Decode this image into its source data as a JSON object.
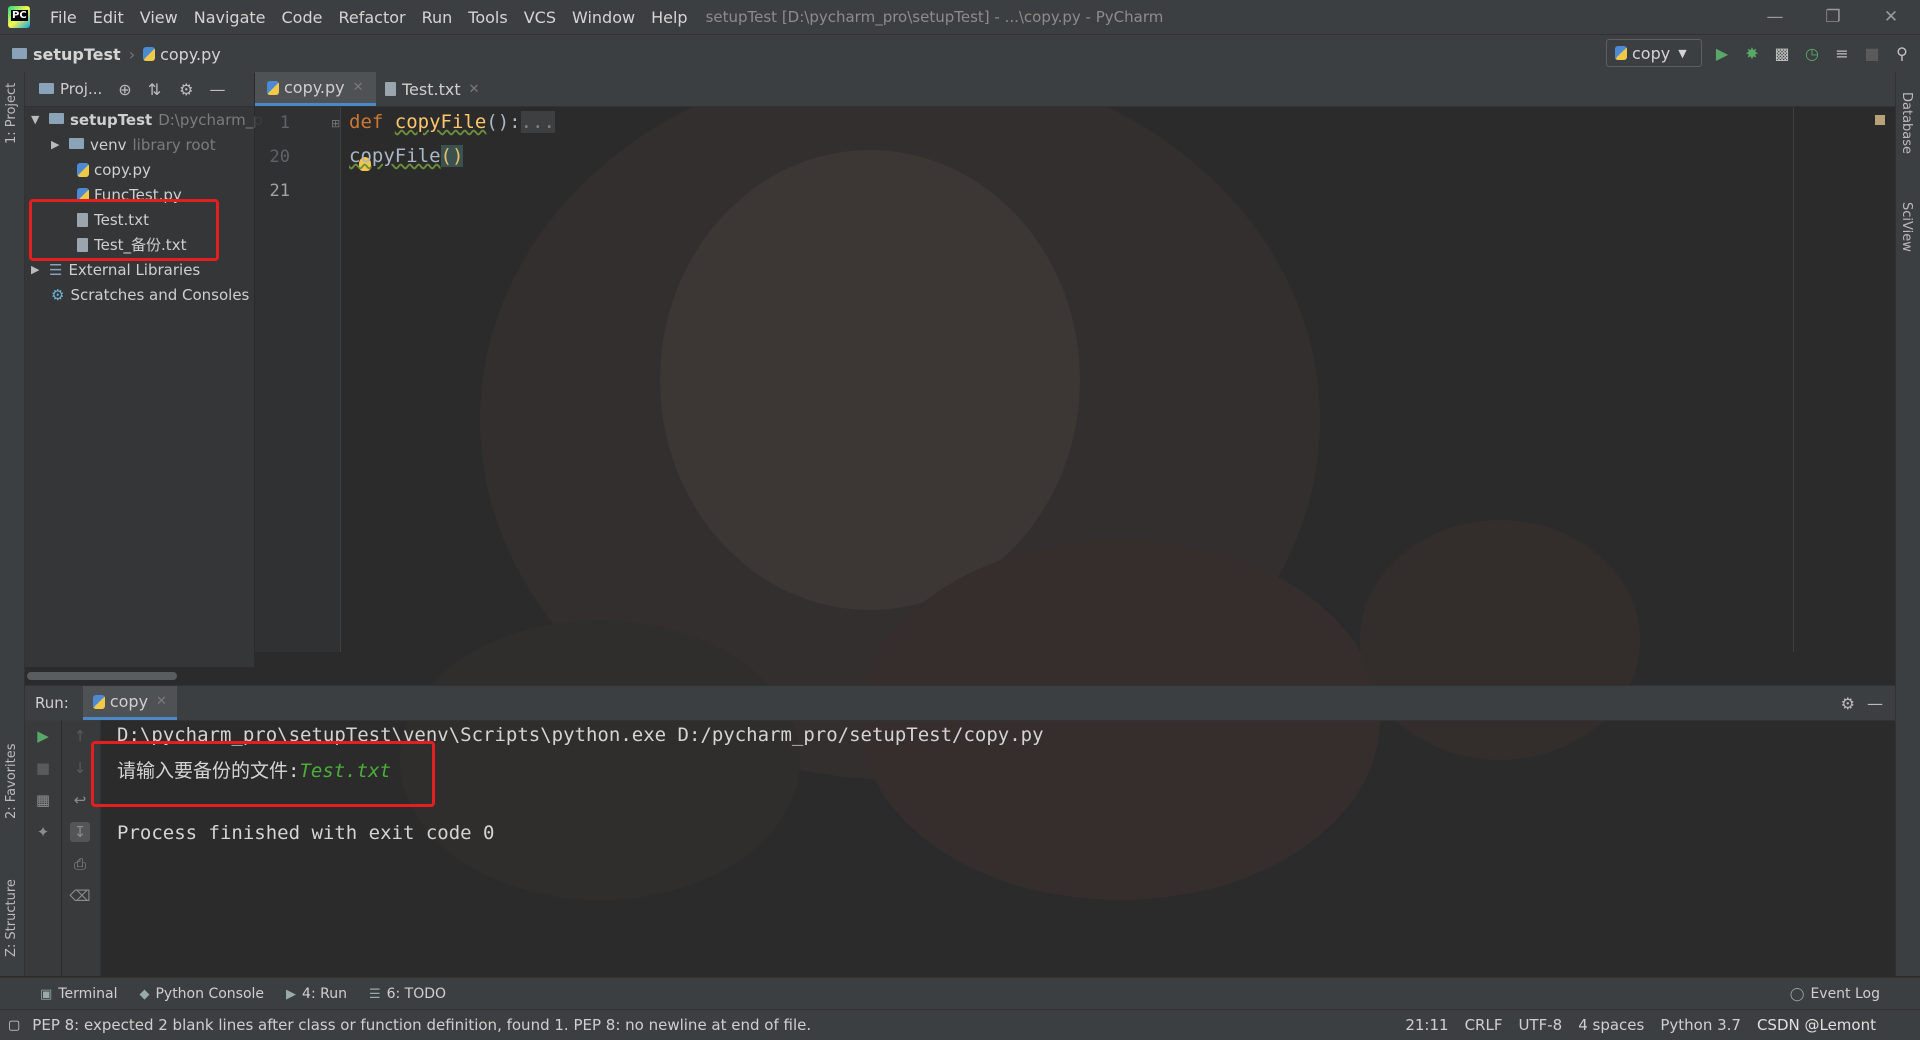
{
  "window": {
    "title": "setupTest [D:\\pycharm_pro\\setupTest] - ...\\copy.py - PyCharm"
  },
  "menu": [
    "File",
    "Edit",
    "View",
    "Navigate",
    "Code",
    "Refactor",
    "Run",
    "Tools",
    "VCS",
    "Window",
    "Help"
  ],
  "navbar": {
    "project": "setupTest",
    "file": "copy.py",
    "run_config": "copy"
  },
  "left_stripe": {
    "project_tab": "1: Project",
    "favorites_tab": "2: Favorites",
    "structure_tab": "Z: Structure"
  },
  "right_stripe": {
    "database_tab": "Database",
    "sciview_tab": "SciView"
  },
  "project_panel": {
    "selector": "Proj...",
    "tree": [
      {
        "label": "setupTest",
        "hint": "D:\\pycharm_p"
      },
      {
        "label": "venv",
        "hint": "library root"
      },
      {
        "label": "copy.py"
      },
      {
        "label": "FuncTest.py"
      },
      {
        "label": "Test.txt"
      },
      {
        "label": "Test_备份.txt"
      },
      {
        "label": "External Libraries"
      },
      {
        "label": "Scratches and Consoles"
      }
    ]
  },
  "editor": {
    "tabs": [
      "copy.py",
      "Test.txt"
    ],
    "line_numbers": [
      "1",
      "20",
      "21"
    ],
    "code": {
      "line1_kw": "def ",
      "line1_fn": "copyFile",
      "line1_rest": "():",
      "line1_fold": "...",
      "line21_fn": "copyFile",
      "line21_paren": "()"
    }
  },
  "run_panel": {
    "label": "Run:",
    "tab": "copy",
    "console": {
      "line1": "D:\\pycharm_pro\\setupTest\\venv\\Scripts\\python.exe D:/pycharm_pro/setupTest/copy.py",
      "prompt": "请输入要备份的文件:",
      "input": "Test.txt",
      "line3": "Process finished with exit code 0"
    }
  },
  "bottom_tabs": [
    "Terminal",
    "Python Console",
    "4: Run",
    "6: TODO"
  ],
  "event_log": "Event Log",
  "status_bar": {
    "message": "PEP 8: expected 2 blank lines after class or function definition, found 1. PEP 8: no newline at end of file.",
    "position": "21:11",
    "line_sep": "CRLF",
    "encoding": "UTF-8",
    "indent": "4 spaces",
    "interpreter": "Python 3.7",
    "watermark": "CSDN @Lemont"
  }
}
